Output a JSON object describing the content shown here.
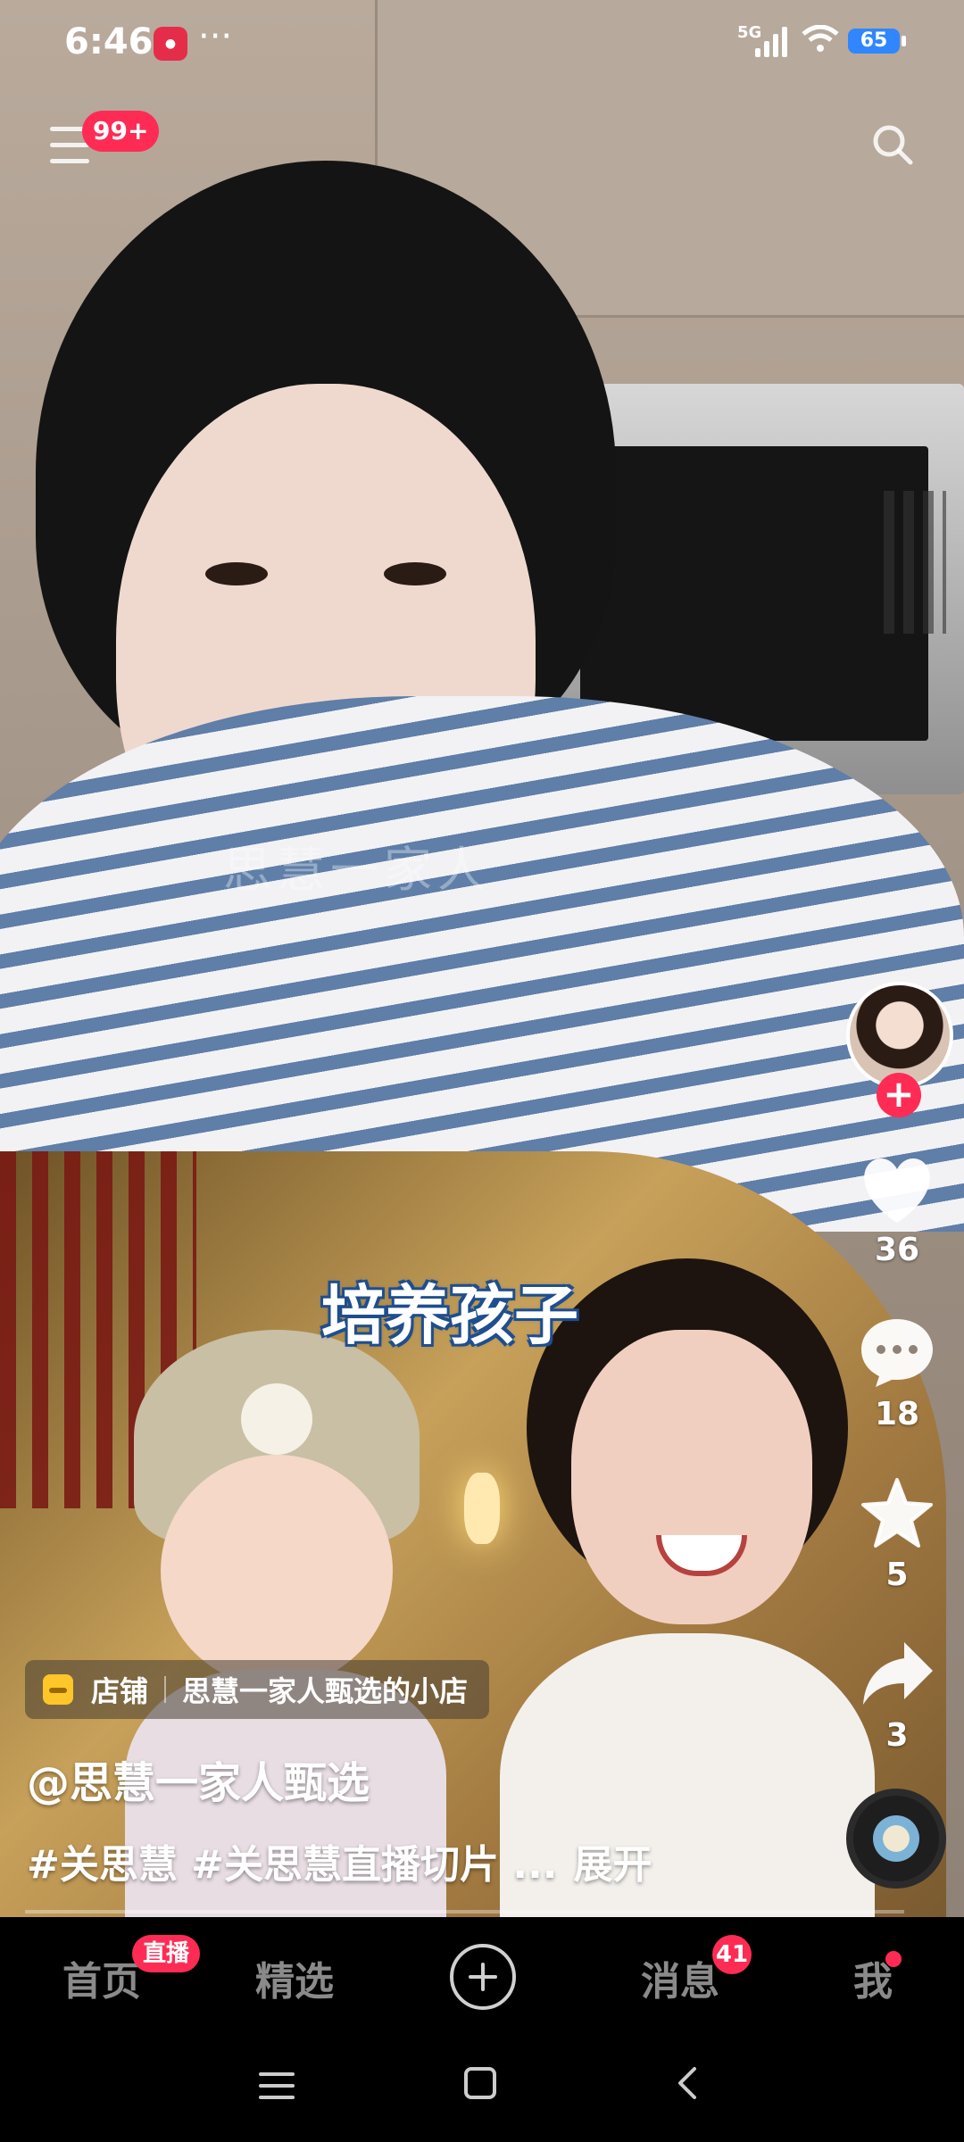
{
  "status_bar": {
    "time": "6:46",
    "more": "···",
    "network": "5G",
    "battery": "65"
  },
  "top_nav": {
    "notification_badge": "99+"
  },
  "video": {
    "watermark": "思慧一家人",
    "overlay_caption": "培养孩子"
  },
  "actions": {
    "like_count": "36",
    "comment_count": "18",
    "favorite_count": "5",
    "share_count": "3",
    "follow_symbol": "+"
  },
  "shop": {
    "label": "店铺",
    "name": "思慧一家人甄选的小店"
  },
  "author": "@思慧一家人甄选",
  "description": {
    "text": "#关思慧 #关思慧直播切片 ...",
    "expand": "展开"
  },
  "tabbar": {
    "home": "首页",
    "home_badge": "直播",
    "featured": "精选",
    "messages": "消息",
    "messages_badge": "41",
    "me": "我"
  },
  "icons": {
    "menu": "menu-icon",
    "search": "search-icon",
    "like": "heart-icon",
    "comment": "comment-icon",
    "favorite": "star-icon",
    "share": "share-icon",
    "create": "plus-circle-icon",
    "shop": "shop-icon"
  },
  "colors": {
    "accent": "#fe2c55",
    "shop_icon": "#ffc62a",
    "battery": "#2f86ff"
  }
}
